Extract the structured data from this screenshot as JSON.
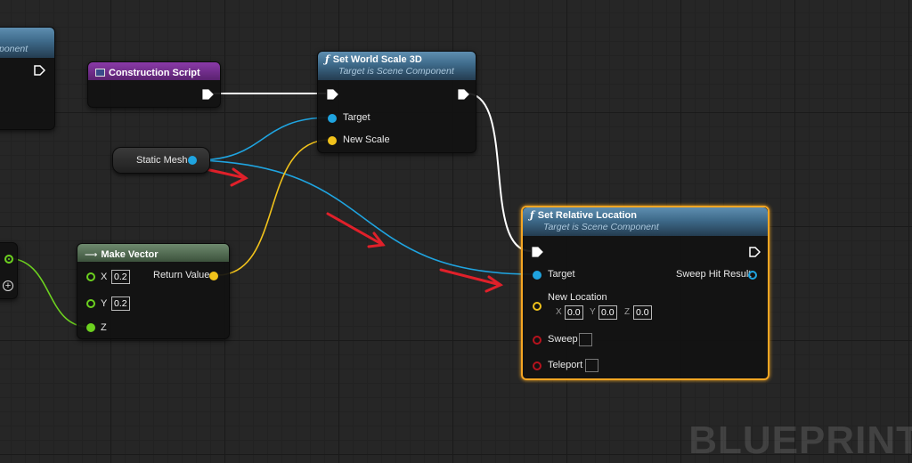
{
  "editor": {
    "watermark": "BLUEPRINT"
  },
  "nodes": {
    "partial_left": {
      "subtitle_fragment": "ponent"
    },
    "construction_script": {
      "title": "Construction Script"
    },
    "set_world_scale": {
      "title": "Set World Scale 3D",
      "subtitle": "Target is Scene Component",
      "pins": {
        "target": "Target",
        "new_scale": "New Scale"
      }
    },
    "static_mesh": {
      "label": "Static Mesh"
    },
    "make_vector": {
      "title": "Make Vector",
      "pins": {
        "x": "X",
        "y": "Y",
        "z": "Z",
        "return_value": "Return Value"
      },
      "values": {
        "x": "0.2",
        "y": "0.2"
      }
    },
    "set_relative_location": {
      "title": "Set Relative Location",
      "subtitle": "Target is Scene Component",
      "pins": {
        "target": "Target",
        "sweep_hit_result": "Sweep Hit Result",
        "new_location": "New Location",
        "sweep": "Sweep",
        "teleport": "Teleport"
      },
      "new_location": {
        "x_label": "X",
        "y_label": "Y",
        "z_label": "Z",
        "x": "0.0",
        "y": "0.0",
        "z": "0.0"
      }
    }
  },
  "colors": {
    "exec_wire": "#ffffff",
    "object_pin": "#1fa4e0",
    "vector_pin": "#f1c21b",
    "float_pin": "#6cd11f",
    "bool_pin": "#b7131d",
    "selection": "#f5a623",
    "annotation_arrow": "#e0202a"
  },
  "icons": {
    "function": "function-f-icon",
    "construction_script": "construction-script-icon",
    "make_vector": "make-vector-icon",
    "exec": "exec-arrow-icon",
    "add_pin": "add-pin-icon"
  }
}
